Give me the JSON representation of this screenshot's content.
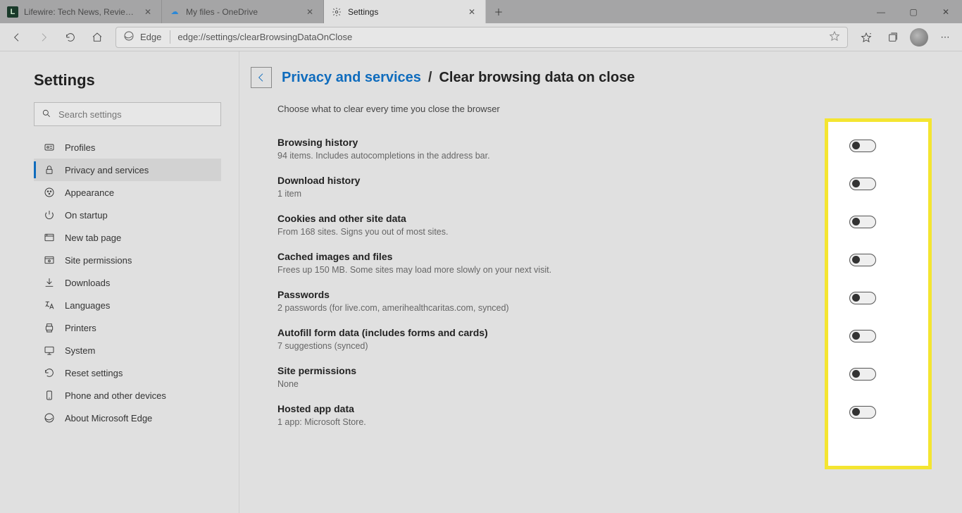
{
  "tabs": [
    {
      "label": "Lifewire: Tech News, Reviews, He",
      "favicon": "L"
    },
    {
      "label": "My files - OneDrive",
      "favicon": "cloud"
    },
    {
      "label": "Settings",
      "favicon": "gear"
    }
  ],
  "toolbar": {
    "edge_label": "Edge",
    "url": "edge://settings/clearBrowsingDataOnClose"
  },
  "sidebar": {
    "title": "Settings",
    "search_placeholder": "Search settings",
    "items": [
      {
        "label": "Profiles",
        "icon": "profile"
      },
      {
        "label": "Privacy and services",
        "icon": "lock",
        "active": true
      },
      {
        "label": "Appearance",
        "icon": "appearance"
      },
      {
        "label": "On startup",
        "icon": "power"
      },
      {
        "label": "New tab page",
        "icon": "newtab"
      },
      {
        "label": "Site permissions",
        "icon": "siteperm"
      },
      {
        "label": "Downloads",
        "icon": "download"
      },
      {
        "label": "Languages",
        "icon": "lang"
      },
      {
        "label": "Printers",
        "icon": "printer"
      },
      {
        "label": "System",
        "icon": "system"
      },
      {
        "label": "Reset settings",
        "icon": "reset"
      },
      {
        "label": "Phone and other devices",
        "icon": "phone"
      },
      {
        "label": "About Microsoft Edge",
        "icon": "edge"
      }
    ]
  },
  "breadcrumb": {
    "link": "Privacy and services",
    "current": "Clear browsing data on close"
  },
  "subtitle": "Choose what to clear every time you close the browser",
  "settings": [
    {
      "title": "Browsing history",
      "desc": "94 items. Includes autocompletions in the address bar.",
      "on": false
    },
    {
      "title": "Download history",
      "desc": "1 item",
      "on": false
    },
    {
      "title": "Cookies and other site data",
      "desc": "From 168 sites. Signs you out of most sites.",
      "on": false
    },
    {
      "title": "Cached images and files",
      "desc": "Frees up 150 MB. Some sites may load more slowly on your next visit.",
      "on": false
    },
    {
      "title": "Passwords",
      "desc": "2 passwords (for live.com, amerihealthcaritas.com, synced)",
      "on": false
    },
    {
      "title": "Autofill form data (includes forms and cards)",
      "desc": "7 suggestions (synced)",
      "on": false
    },
    {
      "title": "Site permissions",
      "desc": "None",
      "on": false
    },
    {
      "title": "Hosted app data",
      "desc": "1 app: Microsoft Store.",
      "on": false
    }
  ]
}
